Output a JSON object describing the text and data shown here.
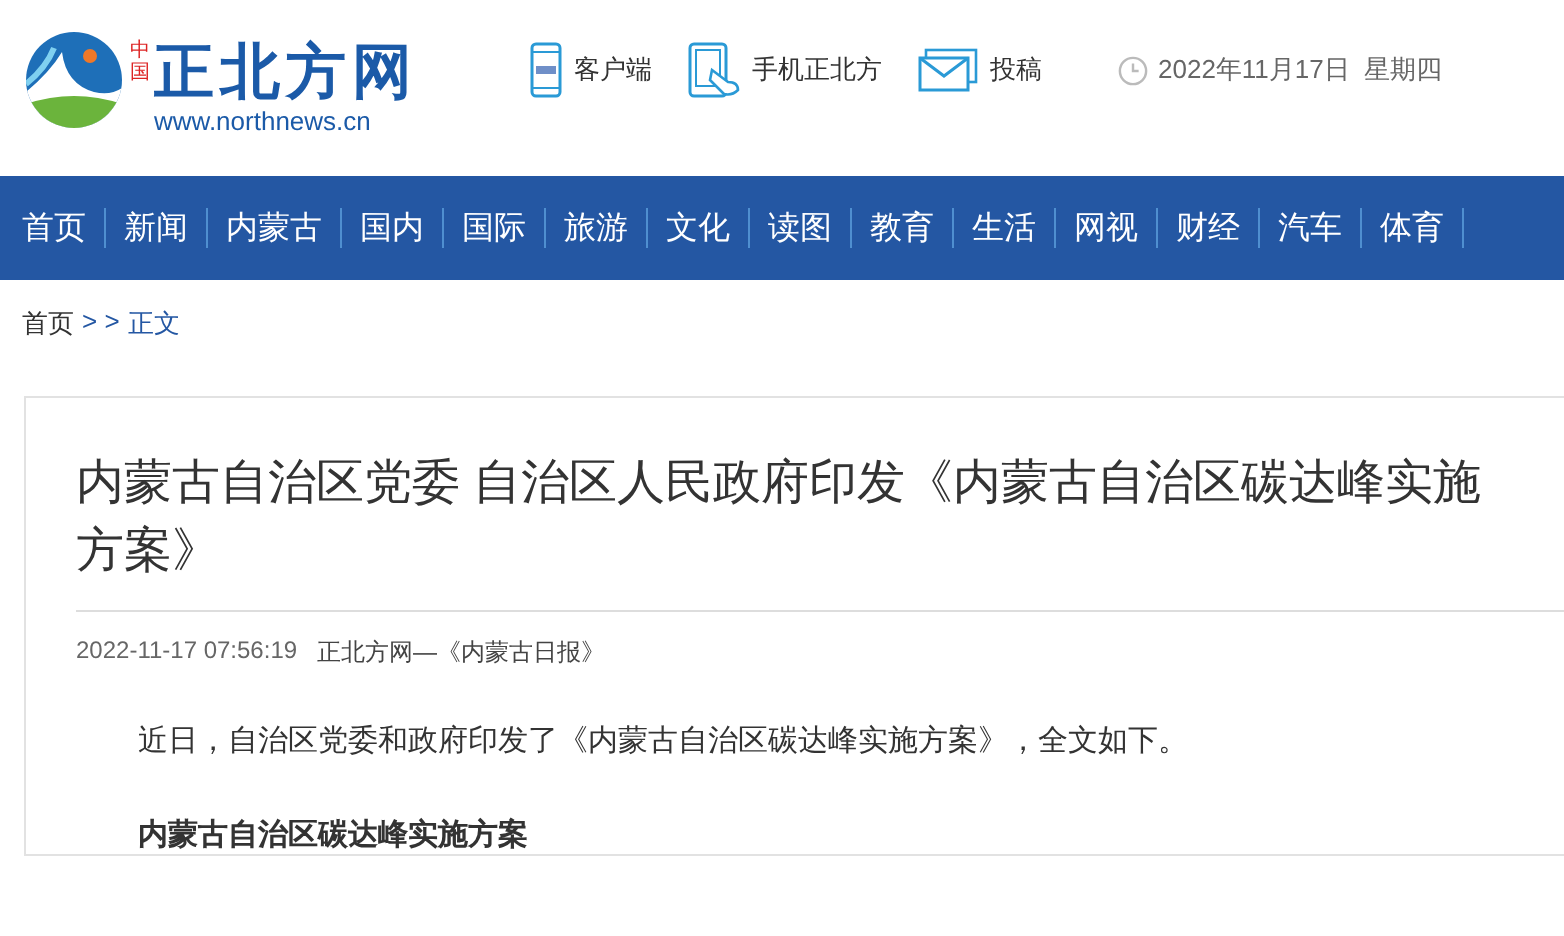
{
  "logo": {
    "seal": "中国",
    "name": "正北方网",
    "url": "www.northnews.cn"
  },
  "top_links": [
    {
      "kind": "app",
      "label": "客户端"
    },
    {
      "kind": "mobile",
      "label": "手机正北方"
    },
    {
      "kind": "mail",
      "label": "投稿"
    }
  ],
  "date": "2022年11月17日  星期四",
  "nav": [
    "首页",
    "新闻",
    "内蒙古",
    "国内",
    "国际",
    "旅游",
    "文化",
    "读图",
    "教育",
    "生活",
    "网视",
    "财经",
    "汽车",
    "体育"
  ],
  "breadcrumb": {
    "home": "首页",
    "separator": "> >",
    "current": "正文"
  },
  "article": {
    "title": "内蒙古自治区党委 自治区人民政府印发《内蒙古自治区碳达峰实施方案》",
    "timestamp": "2022-11-17 07:56:19",
    "source": "正北方网—《内蒙古日报》",
    "paragraphs": [
      {
        "kind": "text",
        "text": "近日，自治区党委和政府印发了《内蒙古自治区碳达峰实施方案》，全文如下。"
      },
      {
        "kind": "heading",
        "text": "内蒙古自治区碳达峰实施方案"
      }
    ]
  }
}
